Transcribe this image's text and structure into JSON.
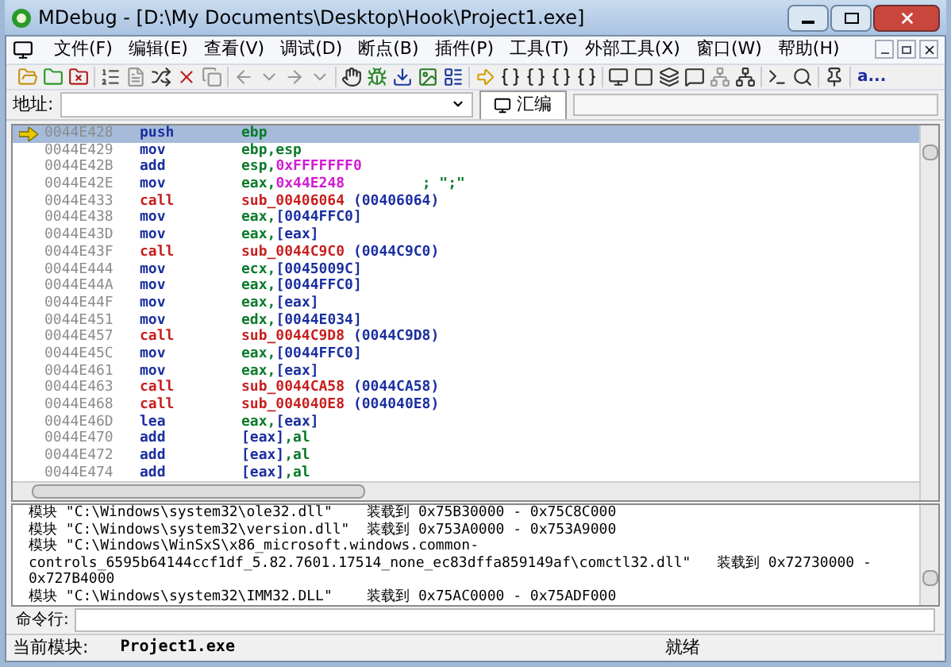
{
  "window": {
    "title": "MDebug - [D:\\My Documents\\Desktop\\Hook\\Project1.exe]"
  },
  "menu": [
    {
      "label": "文件(F)"
    },
    {
      "label": "编辑(E)"
    },
    {
      "label": "查看(V)"
    },
    {
      "label": "调试(D)"
    },
    {
      "label": "断点(B)"
    },
    {
      "label": "插件(P)"
    },
    {
      "label": "工具(T)"
    },
    {
      "label": "外部工具(X)"
    },
    {
      "label": "窗口(W)"
    },
    {
      "label": "帮助(H)"
    }
  ],
  "toolbar_text": "a...",
  "address": {
    "label": "地址:"
  },
  "tabs": [
    {
      "label": "汇编",
      "selected": true
    }
  ],
  "disassembly": [
    {
      "address": "0044E428",
      "mnemonic": "push",
      "kind": "plain",
      "current": true,
      "operand": [
        {
          "text": "ebp",
          "kind": "reg"
        }
      ]
    },
    {
      "address": "0044E429",
      "mnemonic": "mov",
      "kind": "plain",
      "current": false,
      "operand": [
        {
          "text": "ebp,esp",
          "kind": "reg"
        }
      ]
    },
    {
      "address": "0044E42B",
      "mnemonic": "add",
      "kind": "plain",
      "current": false,
      "operand": [
        {
          "text": "esp,",
          "kind": "reg"
        },
        {
          "text": "0xFFFFFFF0",
          "kind": "imm"
        }
      ]
    },
    {
      "address": "0044E42E",
      "mnemonic": "mov",
      "kind": "plain",
      "current": false,
      "operand": [
        {
          "text": "eax,",
          "kind": "reg"
        },
        {
          "text": "0x44E248",
          "kind": "imm"
        },
        {
          "text": "         ; \";\"",
          "kind": "reg"
        }
      ]
    },
    {
      "address": "0044E433",
      "mnemonic": "call",
      "kind": "call",
      "current": false,
      "operand": [
        {
          "text": "sub_00406064",
          "kind": "sym"
        },
        {
          "text": " (00406064)",
          "kind": "mem"
        }
      ]
    },
    {
      "address": "0044E438",
      "mnemonic": "mov",
      "kind": "plain",
      "current": false,
      "operand": [
        {
          "text": "eax,",
          "kind": "reg"
        },
        {
          "text": "[0044FFC0]",
          "kind": "mem"
        }
      ]
    },
    {
      "address": "0044E43D",
      "mnemonic": "mov",
      "kind": "plain",
      "current": false,
      "operand": [
        {
          "text": "eax,",
          "kind": "reg"
        },
        {
          "text": "[eax]",
          "kind": "mem"
        }
      ]
    },
    {
      "address": "0044E43F",
      "mnemonic": "call",
      "kind": "call",
      "current": false,
      "operand": [
        {
          "text": "sub_0044C9C0",
          "kind": "sym"
        },
        {
          "text": " (0044C9C0)",
          "kind": "mem"
        }
      ]
    },
    {
      "address": "0044E444",
      "mnemonic": "mov",
      "kind": "plain",
      "current": false,
      "operand": [
        {
          "text": "ecx,",
          "kind": "reg"
        },
        {
          "text": "[0045009C]",
          "kind": "mem"
        }
      ]
    },
    {
      "address": "0044E44A",
      "mnemonic": "mov",
      "kind": "plain",
      "current": false,
      "operand": [
        {
          "text": "eax,",
          "kind": "reg"
        },
        {
          "text": "[0044FFC0]",
          "kind": "mem"
        }
      ]
    },
    {
      "address": "0044E44F",
      "mnemonic": "mov",
      "kind": "plain",
      "current": false,
      "operand": [
        {
          "text": "eax,",
          "kind": "reg"
        },
        {
          "text": "[eax]",
          "kind": "mem"
        }
      ]
    },
    {
      "address": "0044E451",
      "mnemonic": "mov",
      "kind": "plain",
      "current": false,
      "operand": [
        {
          "text": "edx,",
          "kind": "reg"
        },
        {
          "text": "[0044E034]",
          "kind": "mem"
        }
      ]
    },
    {
      "address": "0044E457",
      "mnemonic": "call",
      "kind": "call",
      "current": false,
      "operand": [
        {
          "text": "sub_0044C9D8",
          "kind": "sym"
        },
        {
          "text": " (0044C9D8)",
          "kind": "mem"
        }
      ]
    },
    {
      "address": "0044E45C",
      "mnemonic": "mov",
      "kind": "plain",
      "current": false,
      "operand": [
        {
          "text": "eax,",
          "kind": "reg"
        },
        {
          "text": "[0044FFC0]",
          "kind": "mem"
        }
      ]
    },
    {
      "address": "0044E461",
      "mnemonic": "mov",
      "kind": "plain",
      "current": false,
      "operand": [
        {
          "text": "eax,",
          "kind": "reg"
        },
        {
          "text": "[eax]",
          "kind": "mem"
        }
      ]
    },
    {
      "address": "0044E463",
      "mnemonic": "call",
      "kind": "call",
      "current": false,
      "operand": [
        {
          "text": "sub_0044CA58",
          "kind": "sym"
        },
        {
          "text": " (0044CA58)",
          "kind": "mem"
        }
      ]
    },
    {
      "address": "0044E468",
      "mnemonic": "call",
      "kind": "call",
      "current": false,
      "operand": [
        {
          "text": "sub_004040E8",
          "kind": "sym"
        },
        {
          "text": " (004040E8)",
          "kind": "mem"
        }
      ]
    },
    {
      "address": "0044E46D",
      "mnemonic": "lea",
      "kind": "plain",
      "current": false,
      "operand": [
        {
          "text": "eax,",
          "kind": "reg"
        },
        {
          "text": "[eax]",
          "kind": "mem"
        }
      ]
    },
    {
      "address": "0044E470",
      "mnemonic": "add",
      "kind": "plain",
      "current": false,
      "operand": [
        {
          "text": "[eax]",
          "kind": "mem"
        },
        {
          "text": ",al",
          "kind": "reg"
        }
      ]
    },
    {
      "address": "0044E472",
      "mnemonic": "add",
      "kind": "plain",
      "current": false,
      "operand": [
        {
          "text": "[eax]",
          "kind": "mem"
        },
        {
          "text": ",al",
          "kind": "reg"
        }
      ]
    },
    {
      "address": "0044E474",
      "mnemonic": "add",
      "kind": "plain",
      "current": false,
      "operand": [
        {
          "text": "[eax]",
          "kind": "mem"
        },
        {
          "text": ",al",
          "kind": "reg"
        }
      ]
    }
  ],
  "log": [
    "模块 \"C:\\Windows\\system32\\ole32.dll\"    装载到 0x75B30000 - 0x75C8C000",
    "模块 \"C:\\Windows\\system32\\version.dll\"  装载到 0x753A0000 - 0x753A9000",
    "模块 \"C:\\Windows\\WinSxS\\x86_microsoft.windows.common-",
    "controls_6595b64144ccf1df_5.82.7601.17514_none_ec83dffa859149af\\comctl32.dll\"   装载到 0x72730000 -",
    "0x727B4000",
    "模块 \"C:\\Windows\\system32\\IMM32.DLL\"    装载到 0x75AC0000 - 0x75ADF000"
  ],
  "command": {
    "label": "命令行:"
  },
  "status_bar": {
    "module_label": "当前模块:",
    "module": "Project1.exe",
    "state": "就绪"
  }
}
